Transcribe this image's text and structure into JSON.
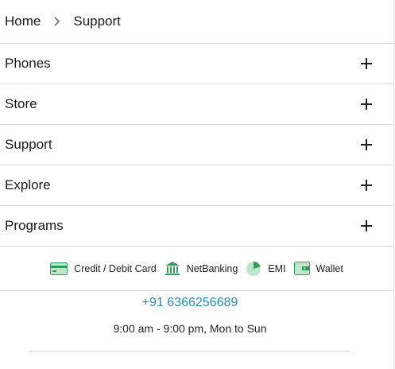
{
  "breadcrumb": {
    "home": "Home",
    "current": "Support"
  },
  "menu": [
    {
      "label": "Phones"
    },
    {
      "label": "Store"
    },
    {
      "label": "Support"
    },
    {
      "label": "Explore"
    },
    {
      "label": "Programs"
    }
  ],
  "payments": [
    {
      "label": "Credit / Debit Card",
      "icon": "card-icon"
    },
    {
      "label": "NetBanking",
      "icon": "bank-icon"
    },
    {
      "label": "EMI",
      "icon": "pie-icon"
    },
    {
      "label": "Wallet",
      "icon": "wallet-icon"
    }
  ],
  "contact": {
    "phone": "+91 6366256689",
    "hours": "9:00 am - 9:00 pm, Mon to Sun"
  },
  "colors": {
    "accent_green": "#2e9c5d",
    "light_green": "#bfe6c9",
    "link_blue": "#2d8ab3"
  }
}
